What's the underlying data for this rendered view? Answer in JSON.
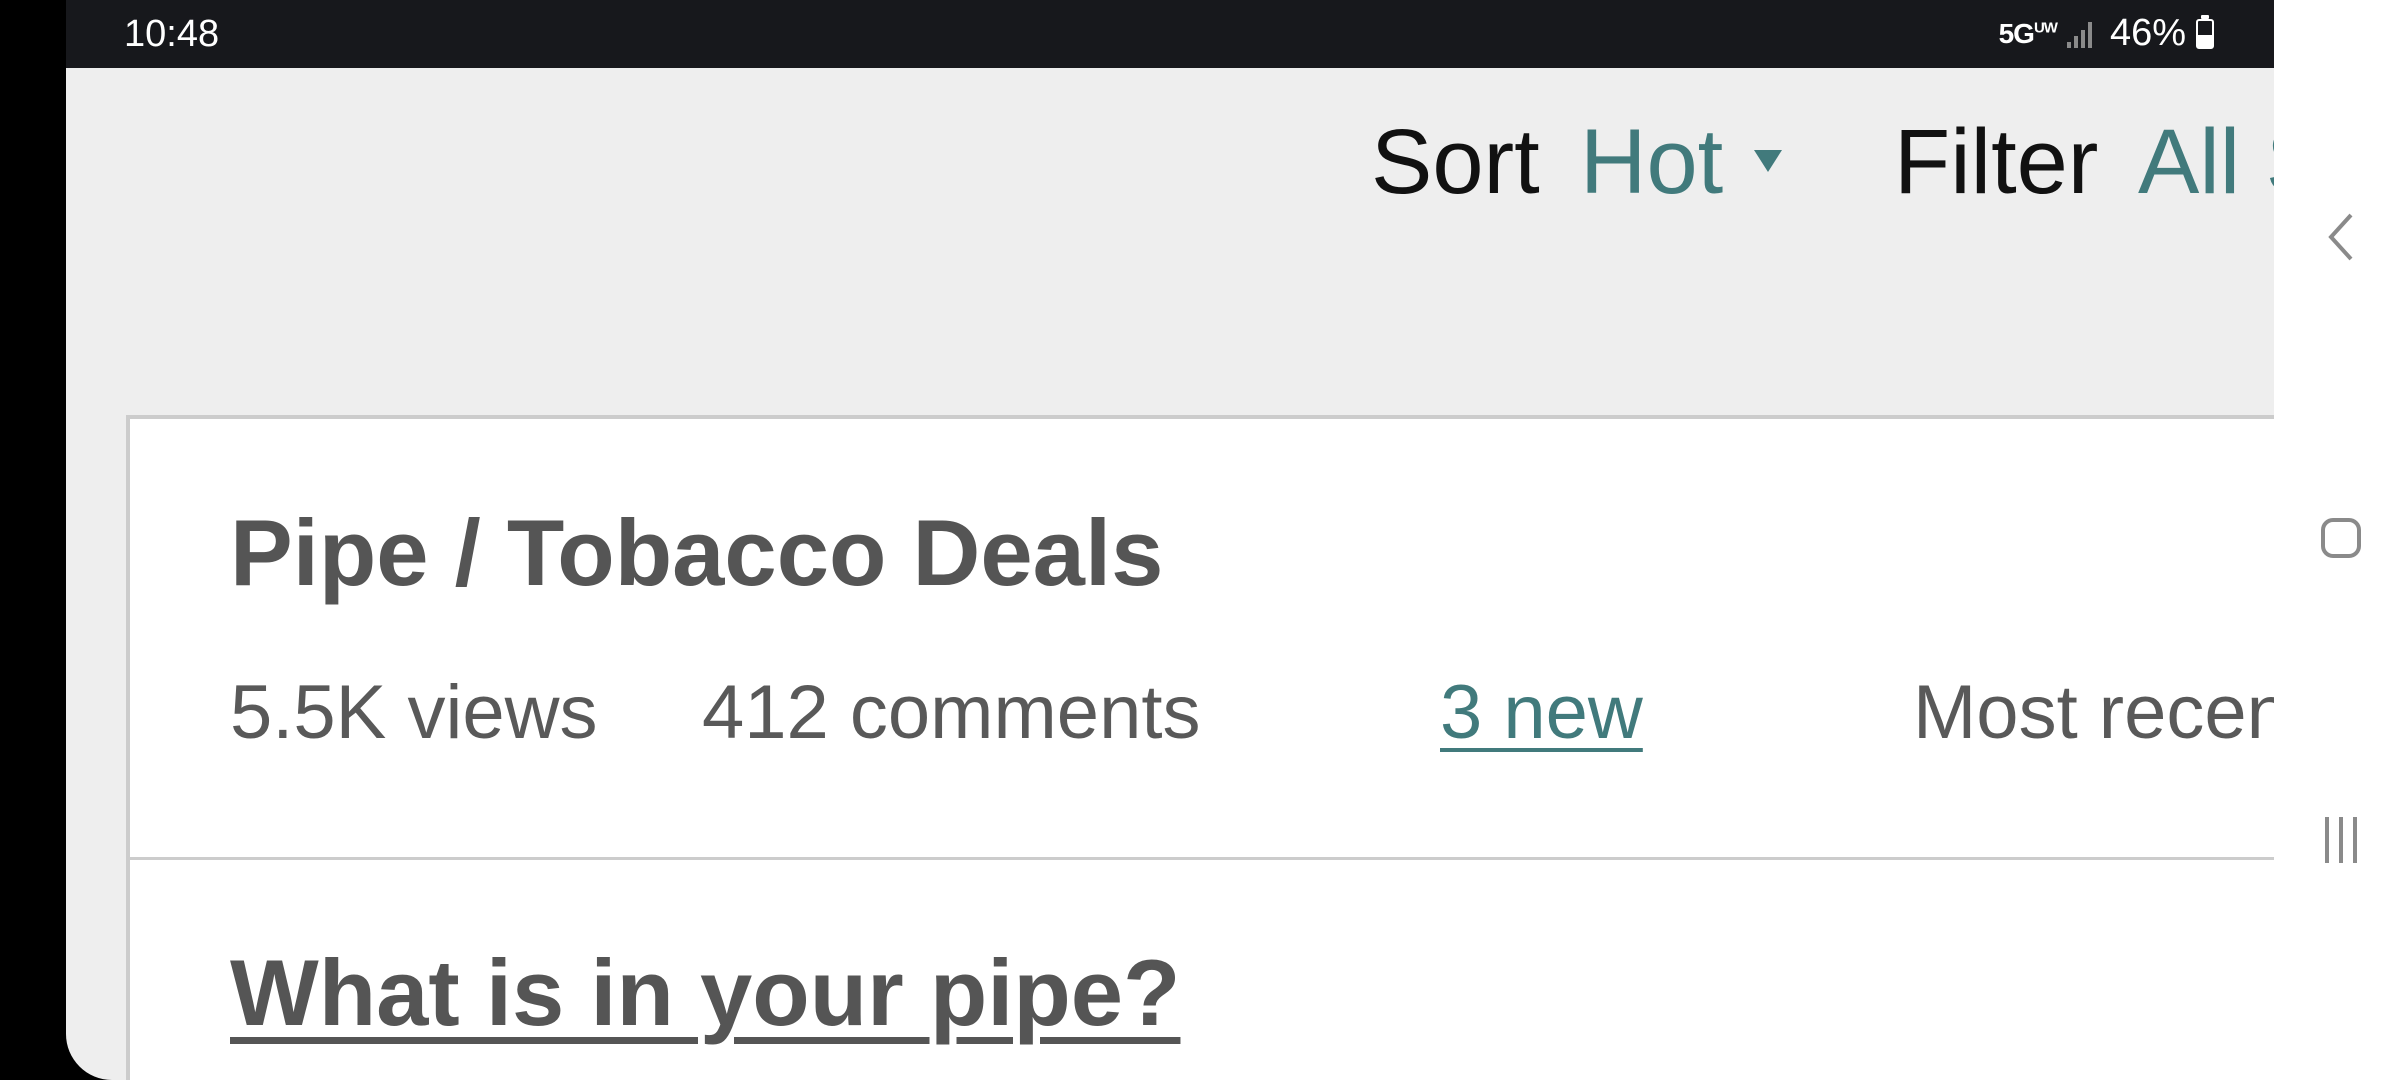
{
  "status_bar": {
    "time": "10:48",
    "network": "5G",
    "network_suffix": "UW",
    "battery": "46%",
    "battery_level": 0.46
  },
  "controls": {
    "sort_label": "Sort",
    "sort_value": "Hot",
    "filter_label": "Filter",
    "filter_value": "All S"
  },
  "category": {
    "title": "Pipe / Tobacco Deals",
    "views": "5.5K views",
    "comments": "412 comments",
    "new_link": "3 new",
    "recent": "Most recent by O"
  },
  "thread": {
    "title": "What is in your pipe?"
  },
  "nav": {
    "back_icon": "chevron-left-icon",
    "home_icon": "home-square-icon",
    "recents_icon": "recent-apps-icon"
  },
  "colors": {
    "accent": "#417a7c",
    "status_bar_bg": "#17181c",
    "page_bg": "#eeeeee",
    "card_text": "#555555"
  }
}
